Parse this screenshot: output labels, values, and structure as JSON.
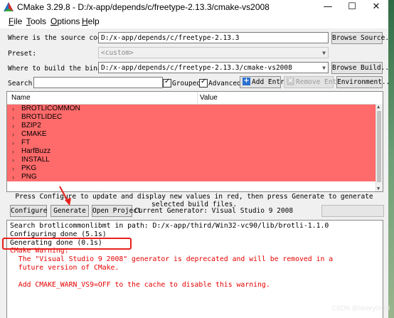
{
  "window": {
    "title": "CMake 3.29.8 - D:/x-app/depends/c/freetype-2.13.3/cmake-vs2008",
    "minimize": "—",
    "maximize": "☐",
    "close": "✕"
  },
  "menu": [
    "File",
    "Tools",
    "Options",
    "Help"
  ],
  "source": {
    "label": "Where is the source code:",
    "value": "D:/x-app/depends/c/freetype-2.13.3",
    "button": "Browse Source..."
  },
  "preset": {
    "label": "Preset:",
    "value": "<custom>"
  },
  "build": {
    "label": "Where to build the binaries:",
    "value": "D:/x-app/depends/c/freetype-2.13.3/cmake-vs2008",
    "button": "Browse Build..."
  },
  "search": {
    "label": "Search:",
    "value": "",
    "grouped_label": "Grouped",
    "grouped_checked": true,
    "advanced_label": "Advanced",
    "advanced_checked": true,
    "add_entry": "Add Entry",
    "remove_entry": "Remove Entry",
    "environment": "Environment..."
  },
  "tree": {
    "col_name": "Name",
    "col_value": "Value",
    "highlight_color": "#ff6a6a",
    "groups": [
      "BROTLICOMMON",
      "BROTLIDEC",
      "BZIP2",
      "CMAKE",
      "FT",
      "HarfBuzz",
      "INSTALL",
      "PKG",
      "PNG"
    ]
  },
  "hint": "Press Configure to update and display new values in red, then press Generate to generate selected build files.",
  "actions": {
    "configure": "Configure",
    "generate": "Generate",
    "open_project": "Open Project",
    "generator": "Current Generator: Visual Studio 9 2008"
  },
  "output": {
    "lines": [
      {
        "text": "Search brotlicommonlibmt in path: D:/x-app/third/Win32-vc90/lib/brotli-1.1.0",
        "color": "black"
      },
      {
        "text": "Configuring done (5.1s)",
        "color": "black"
      },
      {
        "text": "Generating done (0.1s)",
        "color": "black"
      },
      {
        "text": "CMake Warning:",
        "color": "red"
      },
      {
        "text": "  The \"Visual Studio 9 2008\" generator is deprecated and will be removed in a",
        "color": "red"
      },
      {
        "text": "  future version of CMake.",
        "color": "red"
      },
      {
        "text": "",
        "color": "red"
      },
      {
        "text": "  Add CMAKE_WARN_VS9=OFF to the cache to disable this warning.",
        "color": "red"
      }
    ]
  },
  "watermark": "CSDN @binary0010"
}
